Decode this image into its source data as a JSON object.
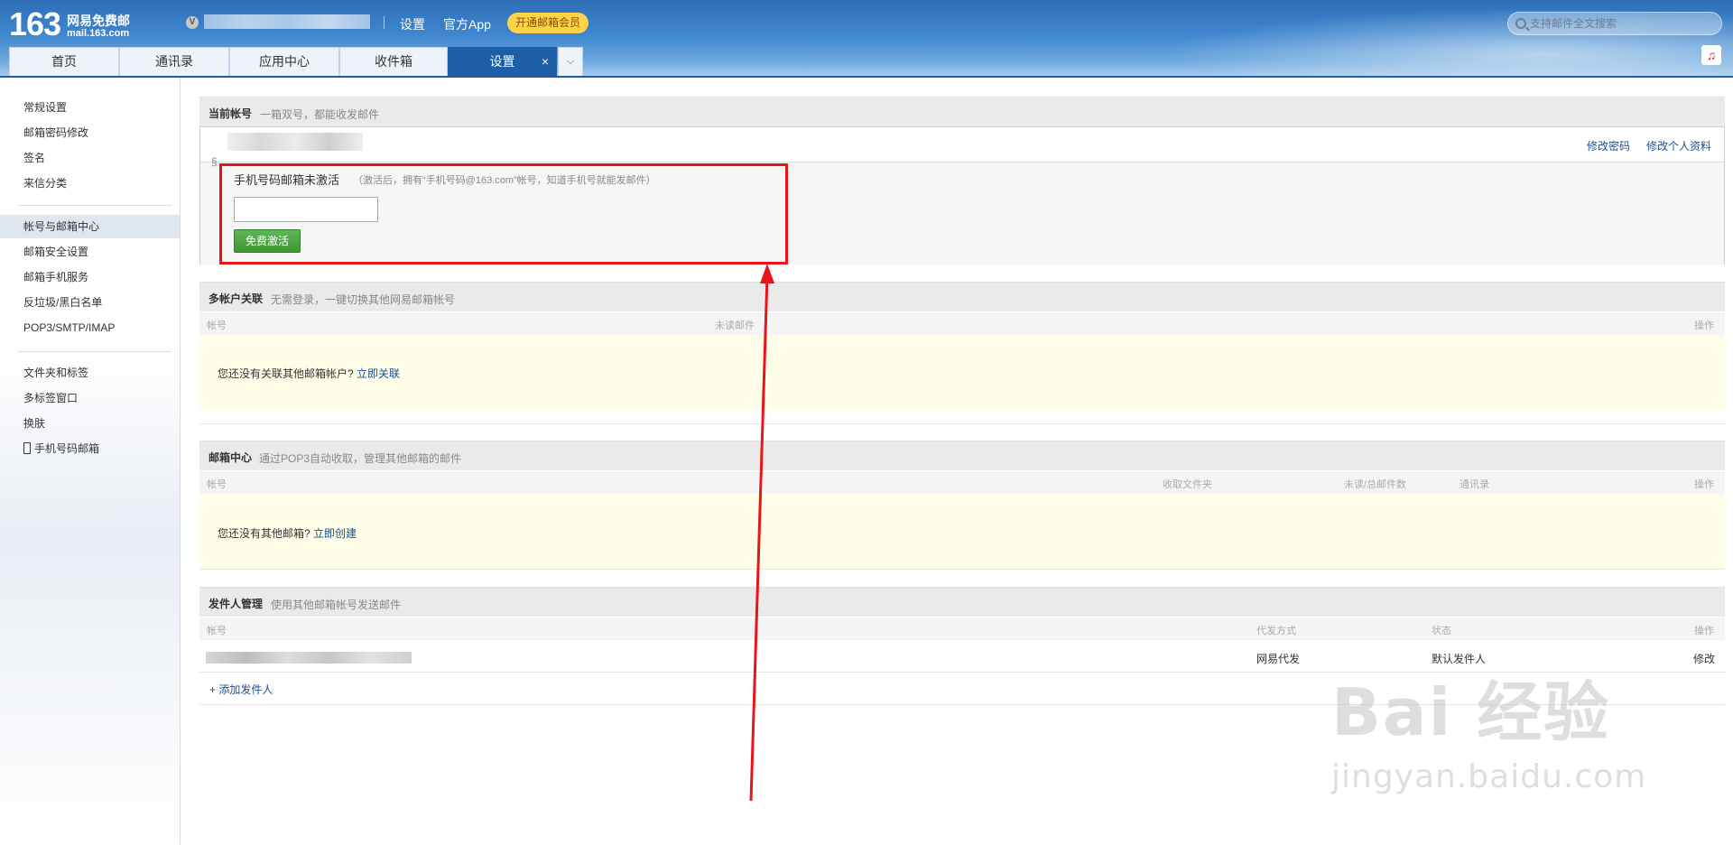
{
  "header": {
    "logo_num": "163",
    "logo_name": "网易免费邮",
    "logo_domain": "mail.163.com",
    "vip_badge": "V",
    "links": [
      "设置",
      "官方App"
    ],
    "vip_button": "开通邮箱会员",
    "search_placeholder": "支持邮件全文搜索"
  },
  "tabs": [
    {
      "label": "首页"
    },
    {
      "label": "通讯录"
    },
    {
      "label": "应用中心"
    },
    {
      "label": "收件箱"
    },
    {
      "label": "设置",
      "active": true
    }
  ],
  "tab_close": "×",
  "tab_more": "⌵",
  "music_icon": "♫",
  "sidebar": {
    "group1": [
      "常规设置",
      "邮箱密码修改",
      "签名",
      "来信分类"
    ],
    "group2": [
      "帐号与邮箱中心",
      "邮箱安全设置",
      "邮箱手机服务",
      "反垃圾/黑白名单",
      "POP3/SMTP/IMAP"
    ],
    "group3": [
      "文件夹和标签",
      "多标签窗口",
      "换肤",
      "手机号码邮箱"
    ],
    "active": "帐号与邮箱中心"
  },
  "current_account": {
    "title": "当前帐号",
    "desc": "一箱双号，都能收发邮件",
    "change_password": "修改密码",
    "edit_profile": "修改个人资料",
    "chain": "§",
    "activate_title": "手机号码邮箱未激活",
    "activate_desc": "（激活后，拥有“手机号码@163.com”帐号，知道手机号就能发邮件）",
    "activate_button": "免费激活",
    "activate_input": ""
  },
  "multi_account": {
    "title": "多帐户关联",
    "desc": "无需登录，一键切换其他网易邮箱帐号",
    "columns": [
      "帐号",
      "未读邮件",
      "操作"
    ],
    "empty_text": "您还没有关联其他邮箱帐户?",
    "empty_link": "立即关联"
  },
  "mailbox_center": {
    "title": "邮箱中心",
    "desc": "通过POP3自动收取，管理其他邮箱的邮件",
    "columns": [
      "帐号",
      "收取文件夹",
      "未读/总邮件数",
      "通讯录",
      "操作"
    ],
    "empty_text": "您还没有其他邮箱?",
    "empty_link": "立即创建"
  },
  "sender_mgmt": {
    "title": "发件人管理",
    "desc": "使用其他邮箱帐号发送邮件",
    "columns": [
      "帐号",
      "代发方式",
      "状态",
      "操作"
    ],
    "row": {
      "method": "网易代发",
      "status": "默认发件人",
      "action": "修改"
    },
    "add_link": "+ 添加发件人"
  },
  "watermark": {
    "big": "Bai 经验",
    "small": "jingyan.baidu.com"
  },
  "colors": {
    "accent": "#1e5ea7",
    "highlight": "#e8141a",
    "green_button": "#4aa540",
    "vip": "#ffd24a"
  }
}
